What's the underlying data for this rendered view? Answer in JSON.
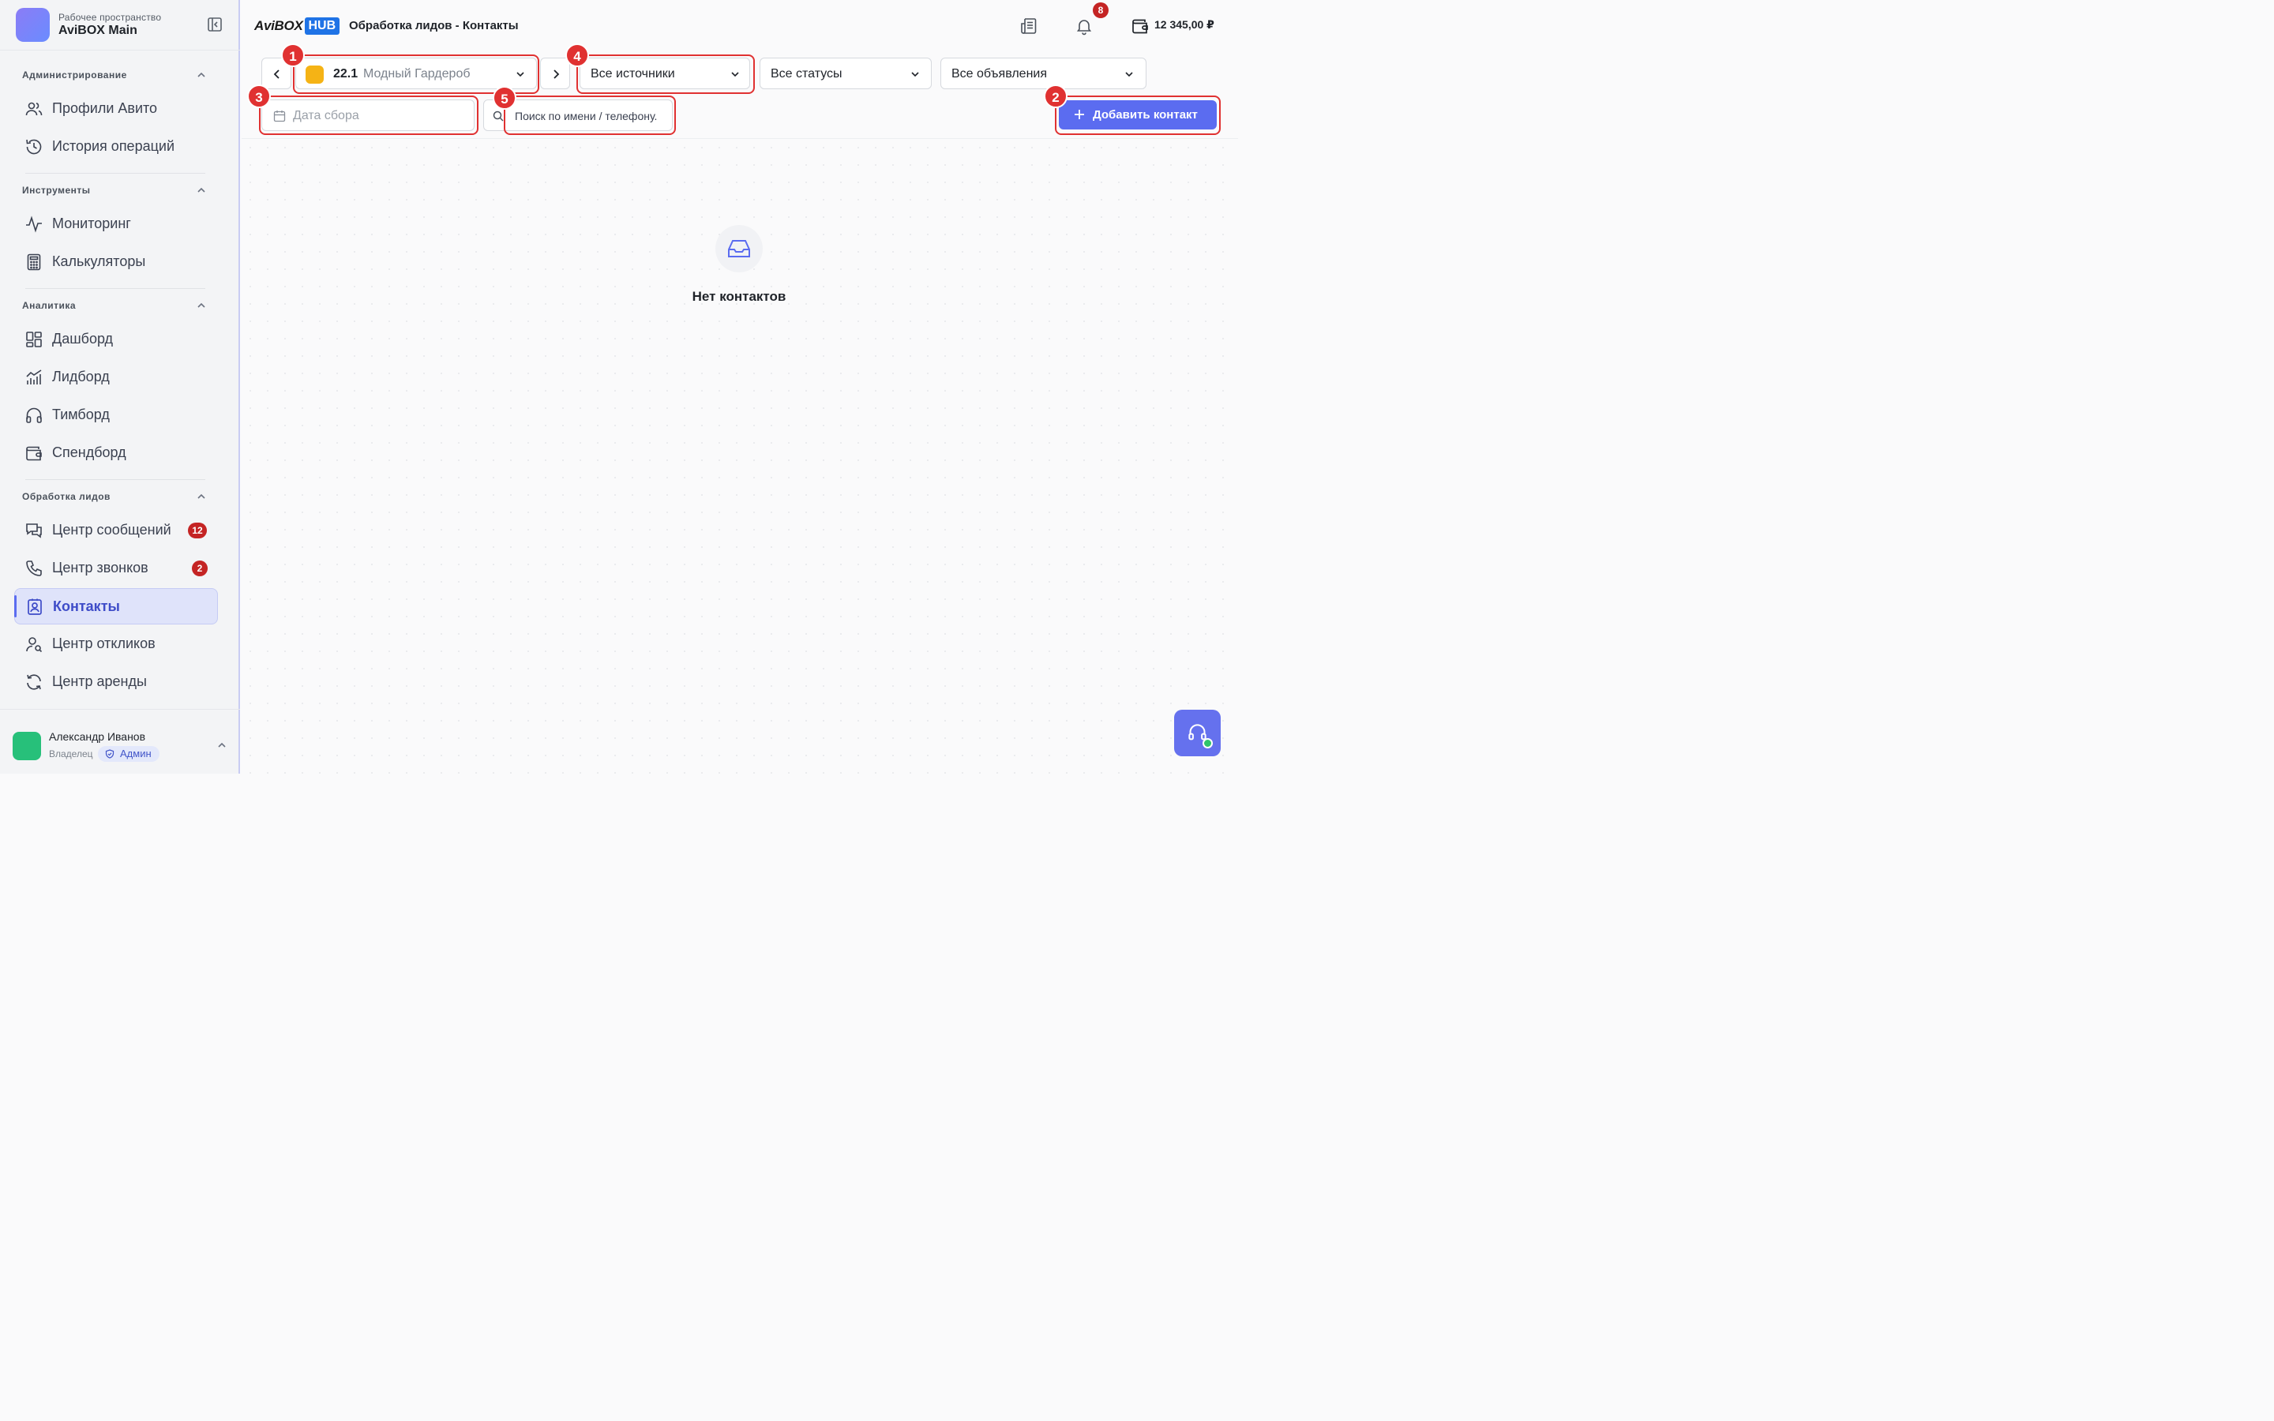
{
  "workspace": {
    "subtitle": "Рабочее пространство",
    "title": "AviBOX Main"
  },
  "sidebar": {
    "sections": [
      {
        "title": "Администрирование",
        "items": [
          {
            "label": "Профили Авито",
            "icon": "users-icon"
          },
          {
            "label": "История операций",
            "icon": "history-icon"
          }
        ]
      },
      {
        "title": "Инструменты",
        "items": [
          {
            "label": "Мониторинг",
            "icon": "activity-icon"
          },
          {
            "label": "Калькуляторы",
            "icon": "calculator-icon"
          }
        ]
      },
      {
        "title": "Аналитика",
        "items": [
          {
            "label": "Дашборд",
            "icon": "dashboard-icon"
          },
          {
            "label": "Лидборд",
            "icon": "chart-icon"
          },
          {
            "label": "Тимборд",
            "icon": "headphones-icon"
          },
          {
            "label": "Спендборд",
            "icon": "wallet-icon"
          }
        ]
      },
      {
        "title": "Обработка лидов",
        "items": [
          {
            "label": "Центр сообщений",
            "icon": "messages-icon",
            "count": "12"
          },
          {
            "label": "Центр звонков",
            "icon": "phone-icon",
            "count": "2"
          },
          {
            "label": "Контакты",
            "icon": "contacts-icon",
            "active": true
          },
          {
            "label": "Центр откликов",
            "icon": "user-search-icon"
          },
          {
            "label": "Центр аренды",
            "icon": "refresh-icon"
          }
        ]
      }
    ]
  },
  "user": {
    "name": "Александр Иванов",
    "role": "Владелец",
    "badge": "Админ"
  },
  "header": {
    "brand_left": "AviBOX",
    "brand_right": "HUB",
    "breadcrumb": "Обработка лидов - Контакты",
    "notifications_count": "8",
    "balance": "12 345,00 ₽"
  },
  "filters": {
    "account_id": "22.1",
    "account_name": "Модный Гардероб",
    "source": "Все источники",
    "status": "Все статусы",
    "ads": "Все объявления",
    "date_placeholder": "Дата сбора",
    "search_placeholder": "Поиск по имени / телефону.",
    "add_button": "Добавить контакт"
  },
  "markers": [
    "1",
    "2",
    "3",
    "4",
    "5"
  ],
  "empty": {
    "text": "Нет контактов"
  },
  "colors": {
    "accent": "#5b6cf0",
    "badge": "#c42424",
    "annotation": "#e03131",
    "hub_blue": "#1f73e6"
  }
}
